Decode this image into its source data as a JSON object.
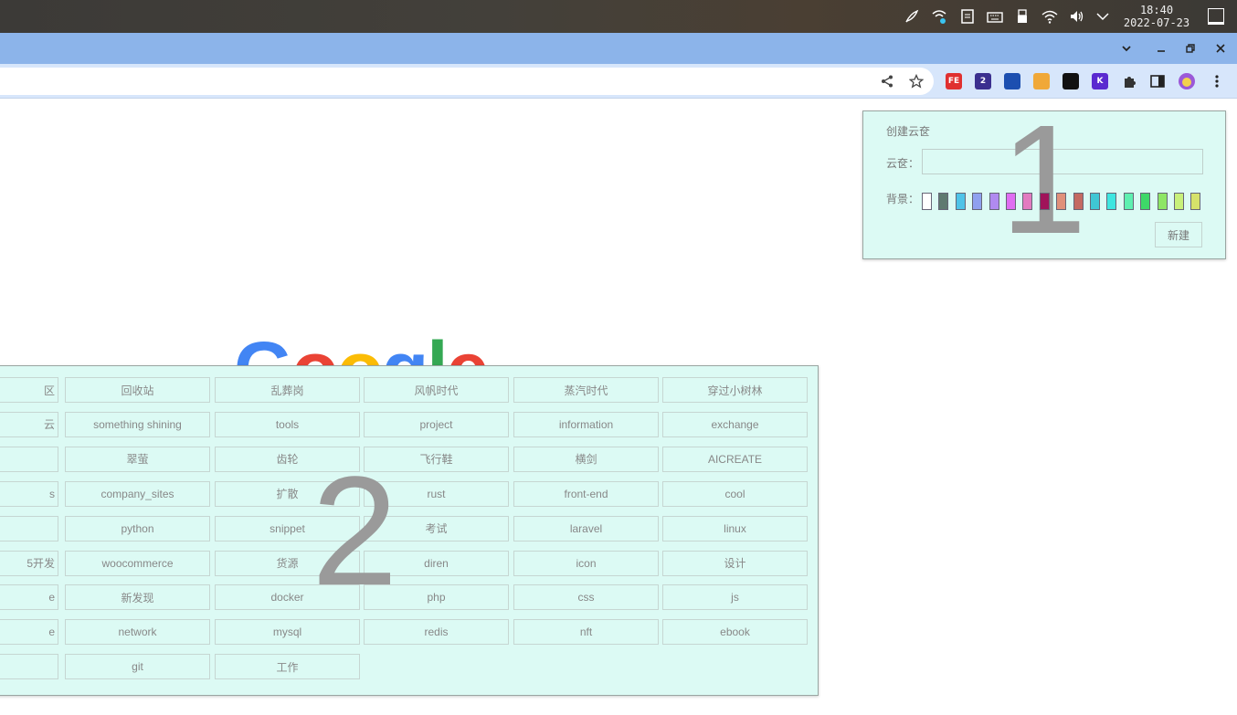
{
  "taskbar": {
    "tray_icons": [
      "feather-icon",
      "network-share-icon",
      "clipboard-icon",
      "keyboard-icon",
      "usb-drive-icon",
      "wifi-icon",
      "volume-icon",
      "chevron-down-icon"
    ],
    "time": "18:40",
    "date": "2022-07-23"
  },
  "toolbar": {
    "extensions": [
      {
        "name": "fe-extension",
        "text": "FE",
        "color": "#e03030"
      },
      {
        "name": "graduation-extension",
        "text": "2",
        "color": "#3b2f8f"
      },
      {
        "name": "security-extension",
        "text": "",
        "color": "#1c4fb0"
      },
      {
        "name": "globe-extension",
        "text": "",
        "color": "#f0a838"
      },
      {
        "name": "mask-extension",
        "text": "",
        "color": "#111111"
      },
      {
        "name": "k-extension",
        "text": "K",
        "color": "#5a2ad0"
      },
      {
        "name": "puzzle-extensions",
        "text": "",
        "color": "#333333"
      }
    ]
  },
  "create_panel": {
    "title": "创建云奁",
    "name_label": "云奁：",
    "name_value": "",
    "bg_label": "背景：",
    "swatches": [
      "#ffffff",
      "#5f7a70",
      "#4fc3e8",
      "#8fa0ef",
      "#b08af0",
      "#e06ef2",
      "#e27bc0",
      "#a0135a",
      "#e0907a",
      "#c46a62",
      "#3fc6d4",
      "#3ee6e0",
      "#5ef0b0",
      "#3ed868",
      "#8ee666",
      "#c8f07a",
      "#d6e26a"
    ],
    "new_button": "新建",
    "overlay_number": "1"
  },
  "list_panel": {
    "overlay_number": "2",
    "rows": [
      [
        "区",
        "回收站",
        "乱葬岗",
        "风帆时代",
        "蒸汽时代",
        "穿过小树林"
      ],
      [
        "云",
        "something shining",
        "tools",
        "project",
        "information",
        "exchange"
      ],
      [
        "",
        "翠萤",
        "齿轮",
        "飞行鞋",
        "横剑",
        "AICREATE"
      ],
      [
        "s",
        "company_sites",
        "扩散",
        "rust",
        "front-end",
        "cool"
      ],
      [
        "",
        "python",
        "snippet",
        "考试",
        "laravel",
        "linux"
      ],
      [
        "5开发",
        "woocommerce",
        "货源",
        "diren",
        "icon",
        "设计"
      ],
      [
        "e",
        "新发现",
        "docker",
        "php",
        "css",
        "js"
      ],
      [
        "e",
        "network",
        "mysql",
        "redis",
        "nft",
        "ebook"
      ],
      [
        "",
        "git",
        "工作"
      ]
    ]
  }
}
